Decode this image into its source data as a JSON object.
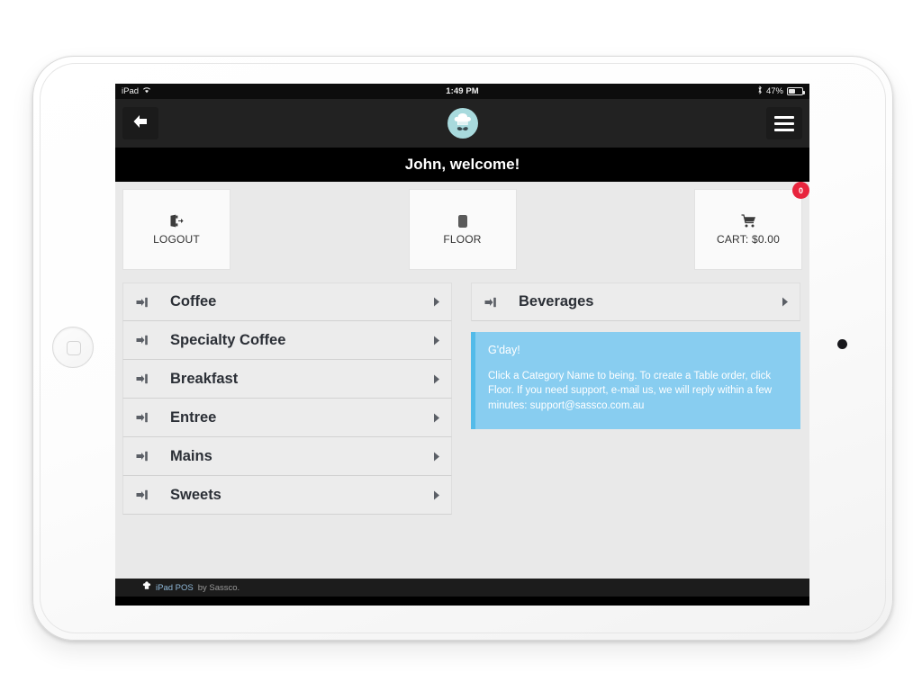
{
  "status_bar": {
    "carrier": "iPad",
    "wifi_icon": "wifi-icon",
    "time": "1:49 PM",
    "bluetooth_icon": "bluetooth-icon",
    "battery_percent": "47%"
  },
  "nav_bar": {
    "back_icon": "back-arrow-icon",
    "logo_icon": "chef-hat-logo-icon",
    "menu_icon": "hamburger-menu-icon"
  },
  "welcome": {
    "text": "John, welcome!"
  },
  "tiles": [
    {
      "label": "LOGOUT",
      "icon": "sign-out-icon",
      "name": "logout"
    },
    {
      "label": "FLOOR",
      "icon": "floor-plan-icon",
      "name": "floor"
    },
    {
      "label": "CART: $0.00",
      "icon": "shopping-cart-icon",
      "name": "cart",
      "badge": "0"
    }
  ],
  "categories_left": [
    {
      "label": "Coffee"
    },
    {
      "label": "Specialty Coffee"
    },
    {
      "label": "Breakfast"
    },
    {
      "label": "Entree"
    },
    {
      "label": "Mains"
    },
    {
      "label": "Sweets"
    }
  ],
  "categories_right": [
    {
      "label": "Beverages"
    }
  ],
  "info_panel": {
    "title": "G'day!",
    "body": "Click a Category Name to being. To create a Table order, click Floor. If you need support, e-mail us, we will reply within a few minutes: support@sassco.com.au"
  },
  "footer": {
    "icon": "chef-hat-icon",
    "brand": "iPad POS",
    "suffix": " by Sassco."
  },
  "colors": {
    "accent_blue": "#88cdf0",
    "accent_blue_border": "#53bbe9",
    "badge_red": "#e8243d",
    "logo_teal": "#a8dadd",
    "nav_dark": "#222222",
    "screen_bg": "#e9e9e9"
  }
}
